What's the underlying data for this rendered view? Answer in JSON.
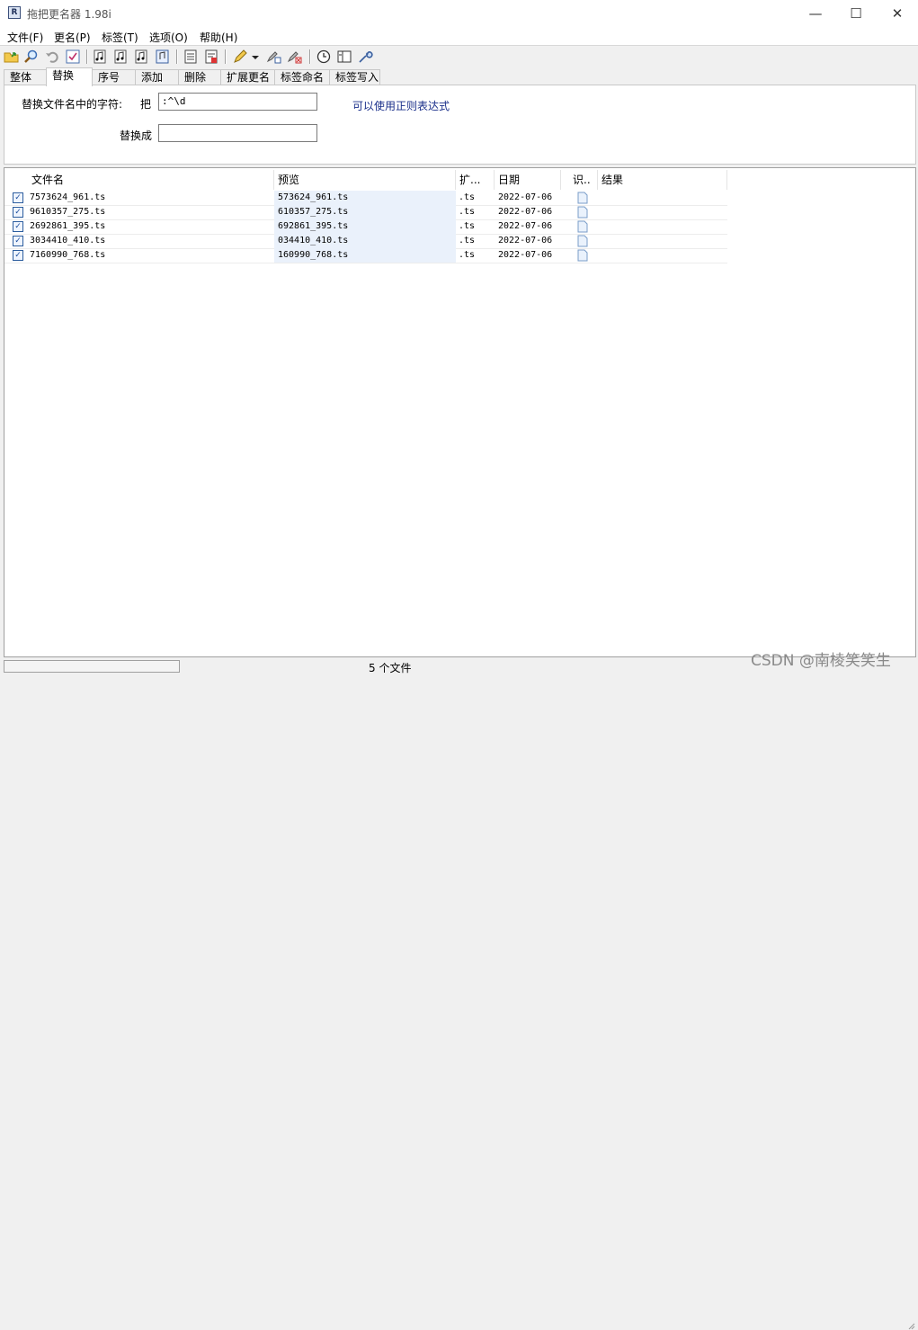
{
  "window": {
    "title": "拖把更名器 1.98i",
    "app_icon": "app-icon",
    "min_glyph": "—",
    "max_glyph": "☐",
    "close_glyph": "✕"
  },
  "menu": [
    "文件(F)",
    "更名(P)",
    "标签(T)",
    "选项(O)",
    "帮助(H)"
  ],
  "toolbar_icons": [
    "open-folder-icon",
    "search-icon",
    "undo-icon",
    "check-icon",
    "music-list-icon",
    "music-replace-icon",
    "music-tag-icon",
    "music-export-icon",
    "document-icon",
    "document-edit-icon",
    "pencil-icon",
    "dropdown-arrow-icon",
    "pencil-add-icon",
    "pencil-delete-icon",
    "clock-icon",
    "panel-icon",
    "tools-icon"
  ],
  "tabs": [
    "整体",
    "替换",
    "序号",
    "添加",
    "删除",
    "扩展更名",
    "标签命名",
    "标签写入"
  ],
  "active_tab": 1,
  "replace_panel": {
    "find_label": "替换文件名中的字符:",
    "find_prefix": "把",
    "find_value": ":^\\d",
    "replace_label": "替换成",
    "replace_value": "",
    "hint": "可以使用正则表达式"
  },
  "file_list": {
    "columns": [
      "文件名",
      "预览",
      "扩...",
      "日期",
      "识..",
      "结果"
    ],
    "rows": [
      {
        "checked": true,
        "name": "7573624_961.ts",
        "preview": "573624_961.ts",
        "ext": ".ts",
        "date": "2022-07-06",
        "result": ""
      },
      {
        "checked": true,
        "name": "9610357_275.ts",
        "preview": "610357_275.ts",
        "ext": ".ts",
        "date": "2022-07-06",
        "result": ""
      },
      {
        "checked": true,
        "name": "2692861_395.ts",
        "preview": "692861_395.ts",
        "ext": ".ts",
        "date": "2022-07-06",
        "result": ""
      },
      {
        "checked": true,
        "name": "3034410_410.ts",
        "preview": "034410_410.ts",
        "ext": ".ts",
        "date": "2022-07-06",
        "result": ""
      },
      {
        "checked": true,
        "name": "7160990_768.ts",
        "preview": "160990_768.ts",
        "ext": ".ts",
        "date": "2022-07-06",
        "result": ""
      }
    ]
  },
  "status": {
    "text": "5 个文件",
    "progress": 0
  },
  "watermark": "CSDN @南棱笑笑生",
  "colors": {
    "hint": "#1a2f8a",
    "preview_bg": "#eaf1fb",
    "check": "#2c5d9e"
  }
}
